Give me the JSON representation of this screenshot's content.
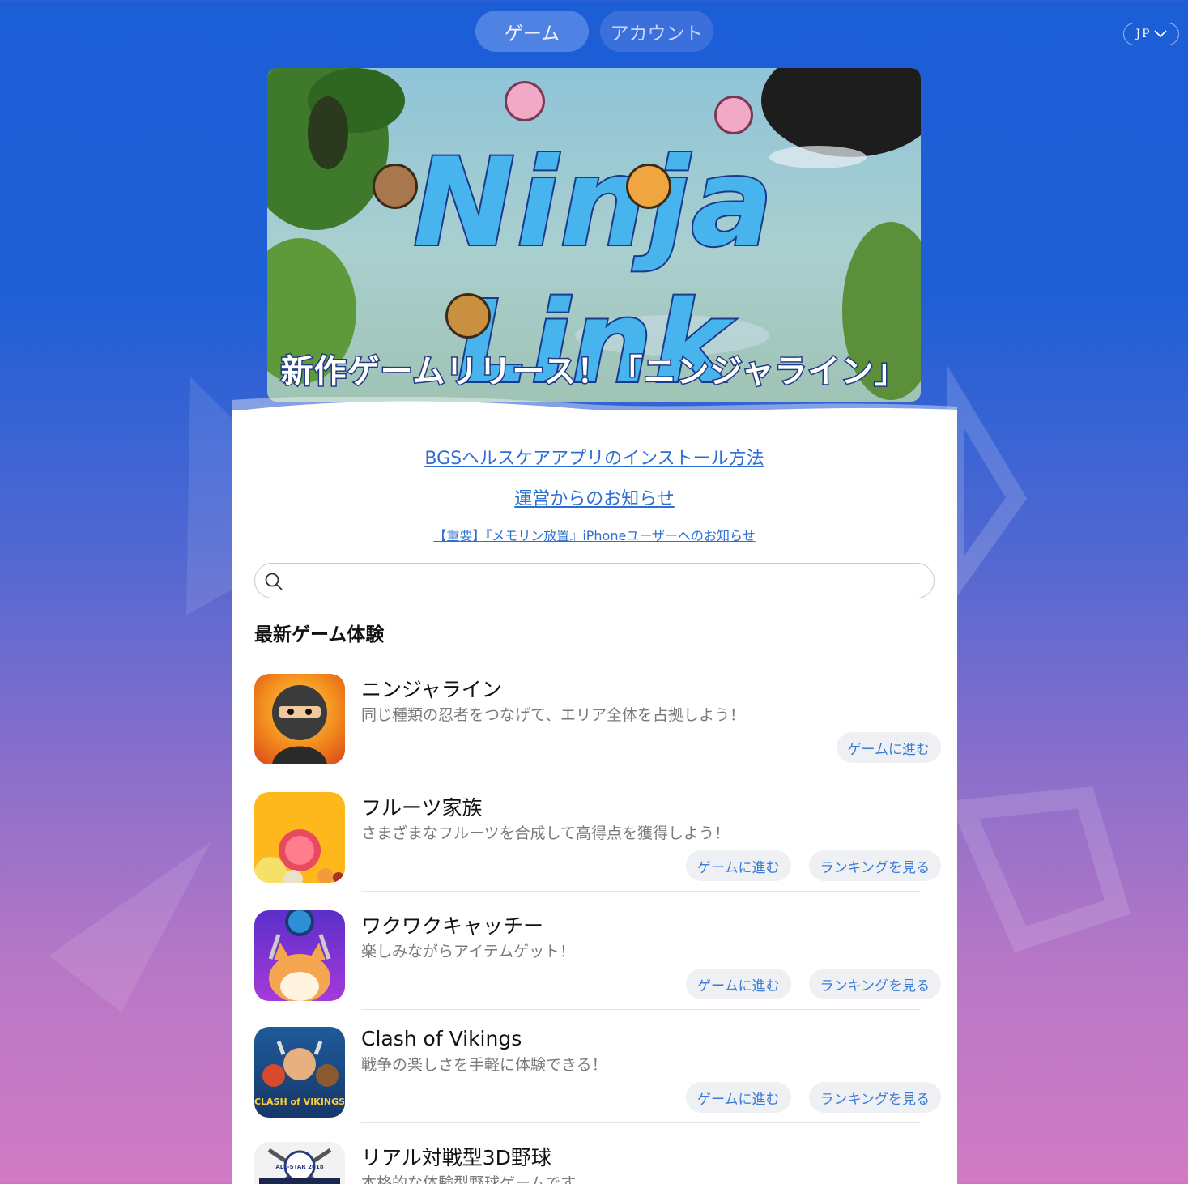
{
  "nav": {
    "tabs": [
      {
        "label": "ゲーム",
        "active": true
      },
      {
        "label": "アカウント",
        "active": false
      }
    ],
    "language": "JP"
  },
  "banner": {
    "title_line1": "Ninja",
    "title_line2": "Link",
    "subtitle": "新作ゲームリリース！「ニンジャライン」"
  },
  "links": [
    "BGSヘルスケアアプリのインストール方法",
    "運営からのお知らせ",
    "【重要】『メモリン放置』iPhoneユーザーへのお知らせ"
  ],
  "search": {
    "placeholder": ""
  },
  "section_title": "最新ゲーム体験",
  "games": [
    {
      "name": "ニンジャライン",
      "desc": "同じ種類の忍者をつなげて、エリア全体を占拠しよう！",
      "play": "ゲームに進む",
      "ranking": ""
    },
    {
      "name": "フルーツ家族",
      "desc": "さまざまなフルーツを合成して高得点を獲得しよう！",
      "play": "ゲームに進む",
      "ranking": "ランキングを見る"
    },
    {
      "name": "ワクワクキャッチー",
      "desc": "楽しみながらアイテムゲット！",
      "play": "ゲームに進む",
      "ranking": "ランキングを見る"
    },
    {
      "name": "Clash of Vikings",
      "desc": "戦争の楽しさを手軽に体験できる！",
      "play": "ゲームに進む",
      "ranking": "ランキングを見る"
    },
    {
      "name": "リアル対戦型3D野球",
      "desc": "本格的な体験型野球ゲームです",
      "play": "",
      "ranking": ""
    }
  ],
  "icon_text": {
    "vikings": "CLASH of VIKINGS",
    "baseball": "ALL-STAR 2018"
  },
  "colors": {
    "link": "#2b6fd4",
    "button_text": "#3a7bd5",
    "button_bg": "#eef0f3",
    "nav_active": "#4f83e3"
  }
}
